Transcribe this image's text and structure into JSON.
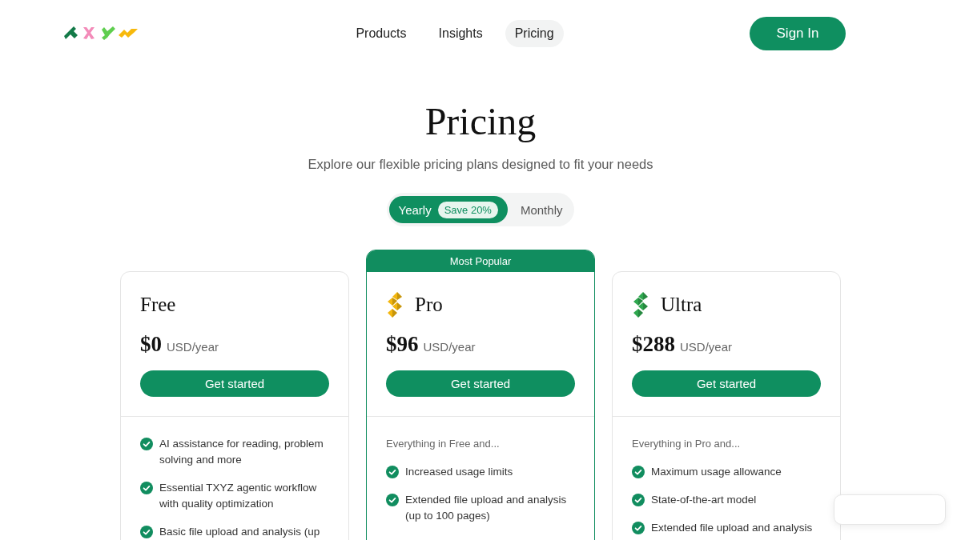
{
  "header": {
    "nav": [
      {
        "label": "Products",
        "selected": false
      },
      {
        "label": "Insights",
        "selected": false
      },
      {
        "label": "Pricing",
        "selected": true
      }
    ],
    "sign_in": "Sign In"
  },
  "hero": {
    "title": "Pricing",
    "subtitle": "Explore our flexible pricing plans designed to fit your needs"
  },
  "billing_toggle": [
    {
      "label": "Yearly",
      "selected": true,
      "badge": "Save 20%"
    },
    {
      "label": "Monthly",
      "selected": false
    }
  ],
  "plans": [
    {
      "name": "Free",
      "highlighted": false,
      "price": "$0",
      "period": "USD/year",
      "button": "Get started",
      "features": [
        "AI assistance for reading, problem solving and more",
        "Essential TXYZ agentic workflow with quality optimization",
        "Basic file upload and analysis (up"
      ]
    },
    {
      "badge": "Most Popular",
      "name": "Pro",
      "color": "#f3b60e",
      "highlighted": true,
      "price": "$96",
      "period": "USD/year",
      "button": "Get started",
      "intro": "Everything in Free and...",
      "features": [
        "Increased usage limits",
        "Extended file upload and analysis (up to 100 pages)"
      ]
    },
    {
      "name": "Ultra",
      "color": "#2fa84f",
      "highlighted": false,
      "price": "$288",
      "period": "USD/year",
      "button": "Get started",
      "intro": "Everything in Pro and...",
      "features": [
        "Maximum usage allowance",
        "State-of-the-art model",
        "Extended file upload and analysis"
      ]
    }
  ]
}
